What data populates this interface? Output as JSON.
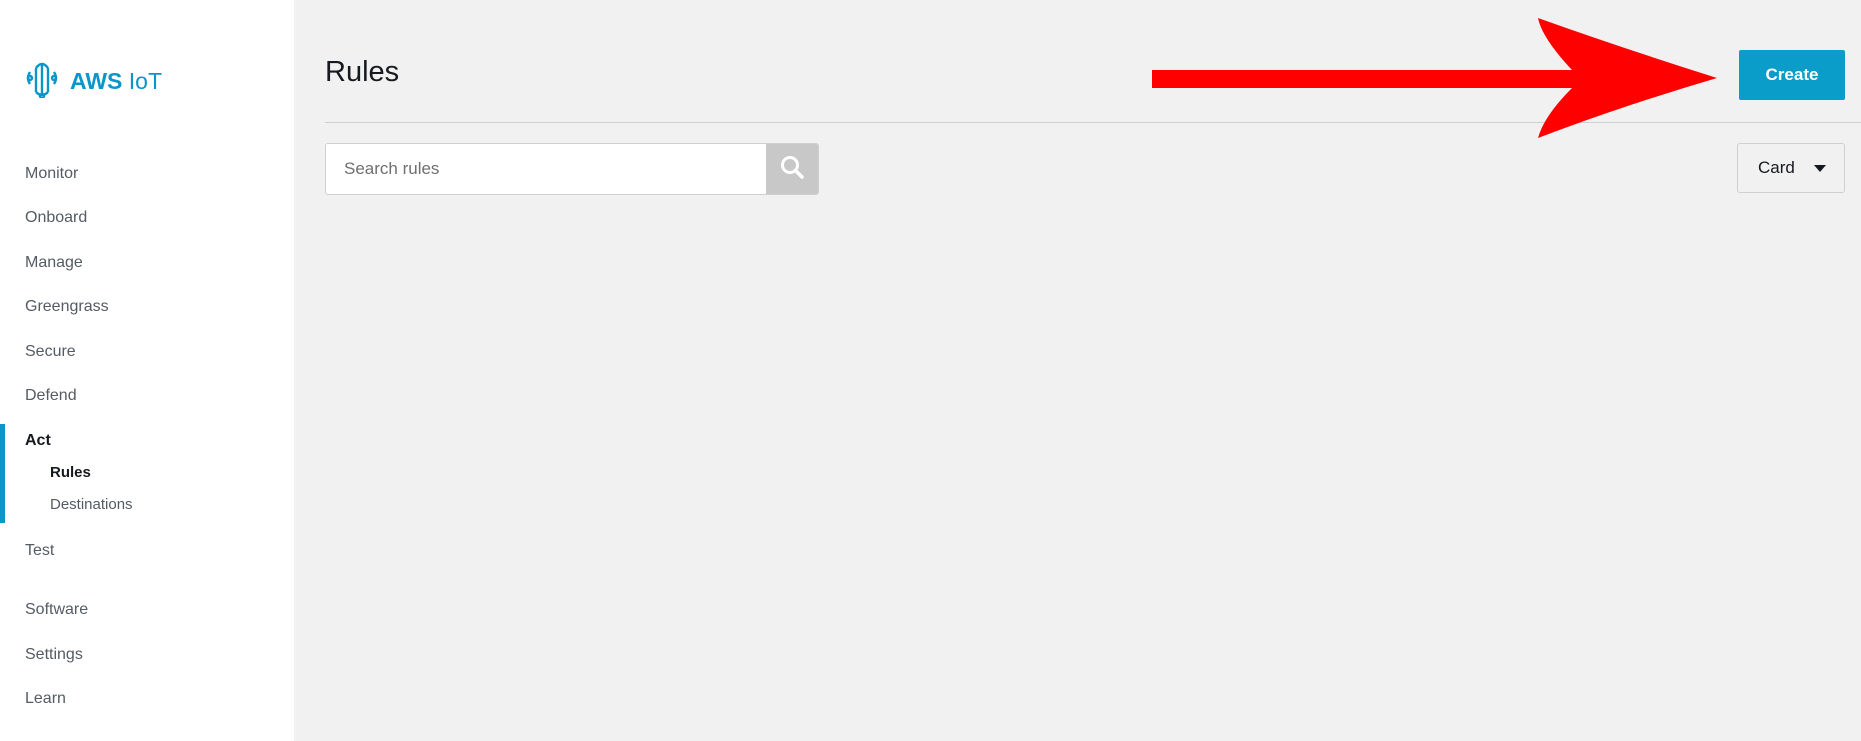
{
  "app": {
    "logo_bold": "AWS",
    "logo_light": "IoT",
    "logo_icon": "aws-iot-chip-icon",
    "accent_color": "#0b96c9"
  },
  "sidebar": {
    "items": [
      {
        "label": "Monitor"
      },
      {
        "label": "Onboard"
      },
      {
        "label": "Manage"
      },
      {
        "label": "Greengrass"
      },
      {
        "label": "Secure"
      },
      {
        "label": "Defend"
      },
      {
        "label": "Act",
        "active": true
      },
      {
        "label": "Test"
      },
      {
        "label": "Software"
      },
      {
        "label": "Settings"
      },
      {
        "label": "Learn"
      }
    ],
    "act_children": [
      {
        "label": "Rules",
        "active": true
      },
      {
        "label": "Destinations"
      }
    ]
  },
  "main": {
    "title": "Rules",
    "create_label": "Create",
    "search": {
      "placeholder": "Search rules",
      "value": "",
      "icon": "search-icon"
    },
    "view_select": {
      "value": "Card",
      "icon": "caret-down-icon"
    }
  },
  "annotation": {
    "icon": "red-arrow-icon",
    "color": "#ff0000"
  }
}
